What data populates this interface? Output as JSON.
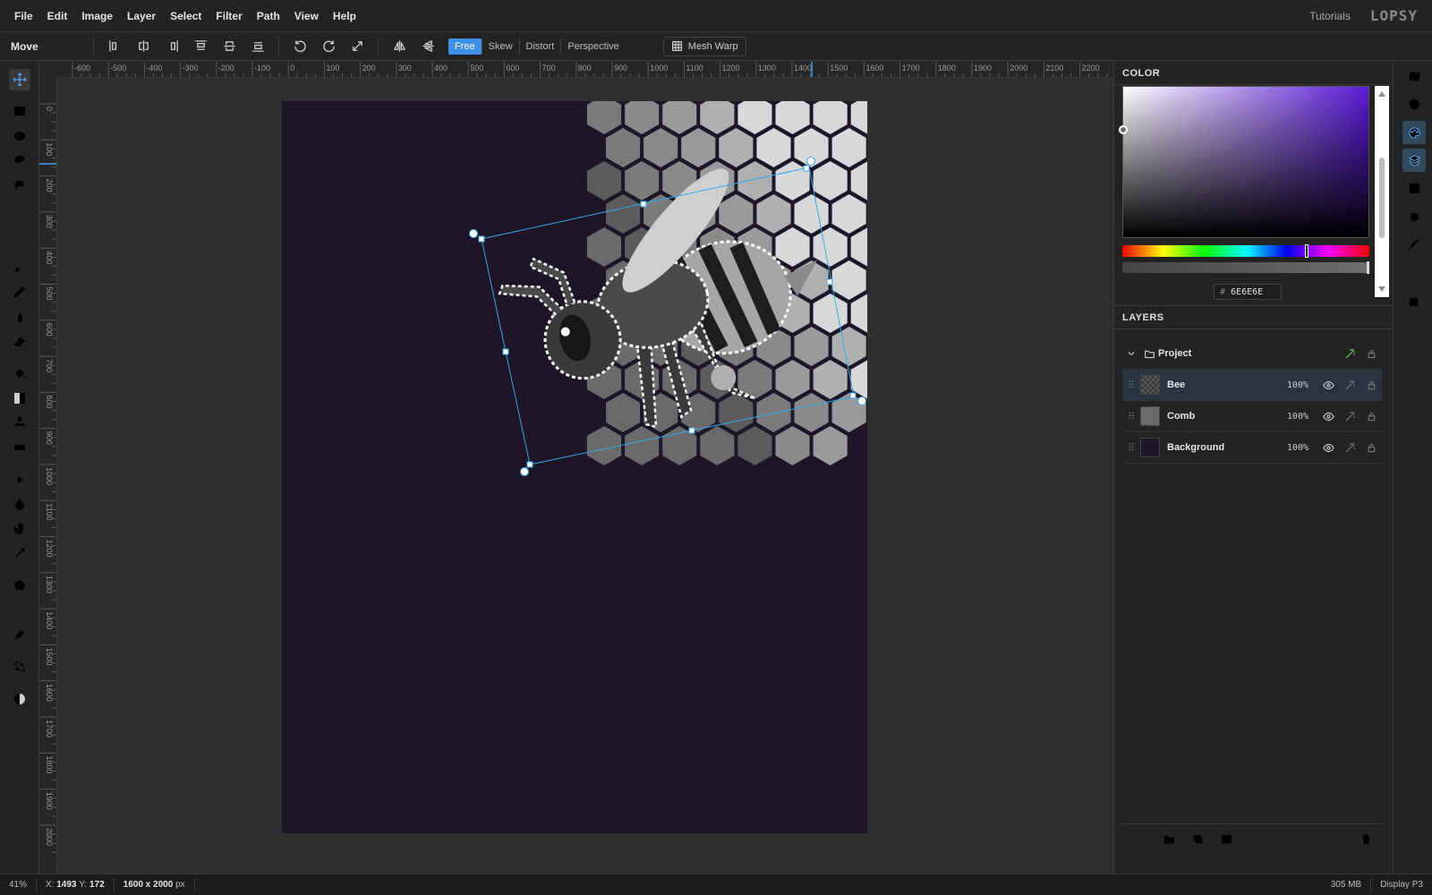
{
  "menu": [
    "File",
    "Edit",
    "Image",
    "Layer",
    "Select",
    "Filter",
    "Path",
    "View",
    "Help"
  ],
  "header": {
    "tutorials": "Tutorials",
    "logo": "LOPSY"
  },
  "toolbar": {
    "tool_name": "Move",
    "align_icons": [
      "align-left-icon",
      "align-hcenter-icon",
      "align-right-icon",
      "align-top-icon",
      "align-vcenter-icon",
      "align-bottom-icon"
    ],
    "transform_icons": [
      "rotate-ccw-icon",
      "rotate-cw-icon",
      "scale-icon",
      "flip-horizontal-icon",
      "flip-vertical-icon"
    ],
    "modes": [
      {
        "label": "Free",
        "active": true
      },
      {
        "label": "Skew",
        "active": false
      },
      {
        "label": "Distort",
        "active": false
      },
      {
        "label": "Perspective",
        "active": false
      }
    ],
    "mesh_warp": "Mesh Warp"
  },
  "left_tools": [
    "move-icon",
    "rect-select-icon",
    "ellipse-select-icon",
    "lasso-icon",
    "magnetic-lasso-icon",
    "magic-wand-icon",
    "quick-select-icon",
    "brush-icon",
    "pencil-icon",
    "spray-icon",
    "eraser-icon",
    "fill-bucket-icon",
    "gradient-icon",
    "stamp-icon",
    "patch-icon",
    "dodge-icon",
    "blur-icon",
    "smudge-icon",
    "eyedropper-icon",
    "shape-icon",
    "text-icon",
    "pen-icon",
    "crop-icon",
    "contrast-icon"
  ],
  "active_tool": "move-icon",
  "rulers": {
    "h_labels": [
      "-600",
      "-500",
      "-400",
      "-300",
      "-200",
      "-100",
      "0",
      "100",
      "200",
      "300",
      "400",
      "500",
      "600",
      "700",
      "800",
      "900",
      "1000",
      "1100",
      "1200",
      "1300",
      "1400",
      "1500",
      "1600",
      "1700",
      "1800",
      "1900",
      "2000",
      "2100",
      "2200"
    ],
    "v_labels": [
      "0",
      "100",
      "200",
      "300",
      "400",
      "500",
      "600",
      "700",
      "800",
      "900",
      "1000",
      "1100",
      "1200",
      "1300",
      "1400",
      "1500",
      "1600",
      "1700",
      "1800",
      "1900",
      "2000"
    ]
  },
  "color_panel": {
    "title": "COLOR",
    "hex": "6E6E6E",
    "hash": "#"
  },
  "layers_panel": {
    "title": "LAYERS",
    "group": "Project",
    "layers": [
      {
        "name": "Bee",
        "opacity": "100%",
        "selected": true
      },
      {
        "name": "Comb",
        "opacity": "100%",
        "selected": false
      },
      {
        "name": "Background",
        "opacity": "100%",
        "selected": false
      }
    ]
  },
  "right_tools": [
    "map-icon",
    "info-icon",
    "palette-icon",
    "layers-icon",
    "columns-icon",
    "history-icon",
    "curve-icon",
    "type-icon",
    "image-add-icon"
  ],
  "status": {
    "zoom": "41%",
    "x_label": "X:",
    "x": "1493",
    "y_label": "Y:",
    "y": "172",
    "dims": "1600 x 2000",
    "dims_unit": "px",
    "memory": "305 MB",
    "profile": "Display P3"
  },
  "colors": {
    "accent": "#3d8fe8",
    "doc_bg": "#1d1629",
    "selection": "#3aa6e8"
  }
}
